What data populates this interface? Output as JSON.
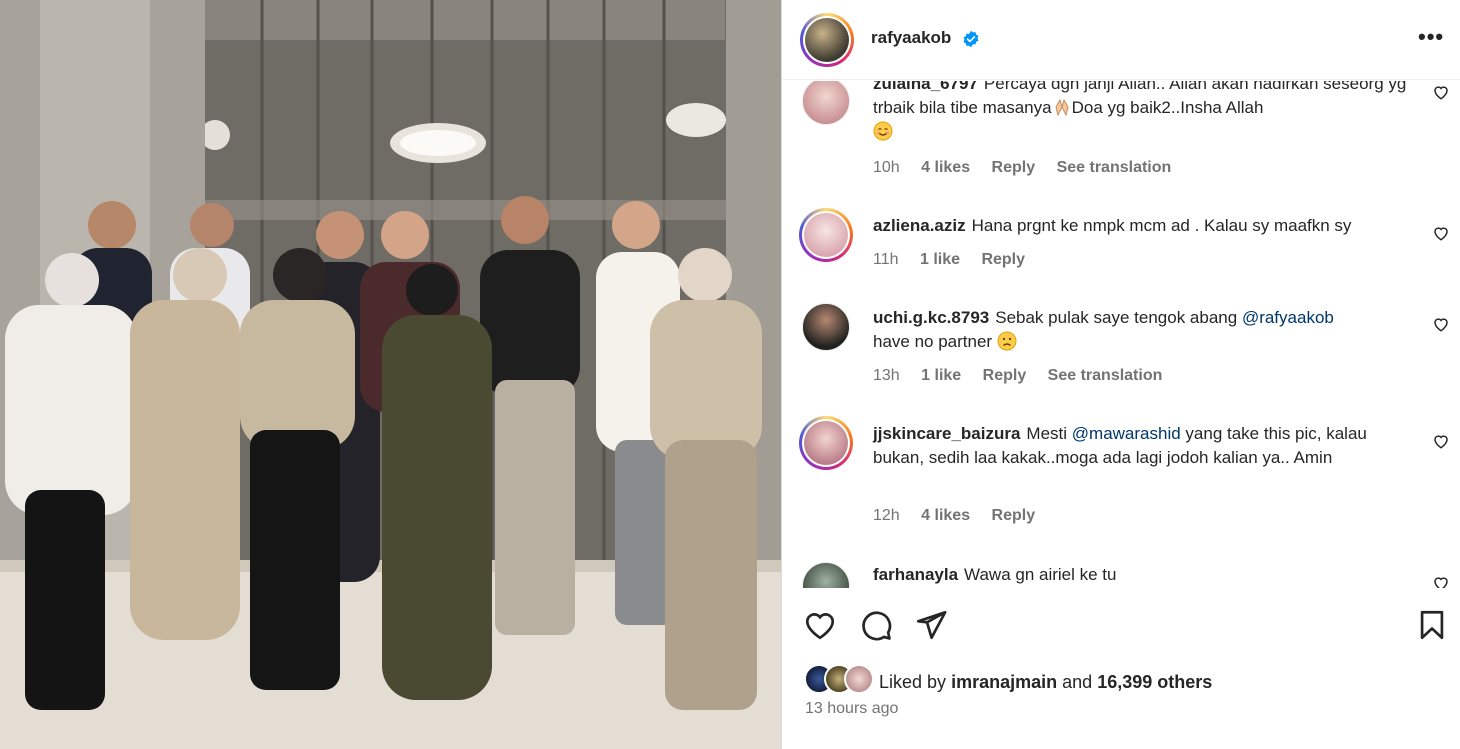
{
  "post": {
    "author": "rafyaakob",
    "verified": true,
    "photo_alt": "Group photo of ten people posing in a mirrored lobby"
  },
  "comments": [
    {
      "username": "zulaina_6797",
      "text": "Percaya dgn janji Allah.. Allah akan hadirkan seseorg yg trbaik bila tibe masanya",
      "text_after": "Doa yg baik2..Insha Allah",
      "time": "10h",
      "likes": "4 likes",
      "reply": "Reply",
      "translation": "See translation"
    },
    {
      "username": "azliena.aziz",
      "text": "Hana prgnt ke nmpk mcm ad . Kalau sy maafkn sy",
      "time": "11h",
      "likes": "1 like",
      "reply": "Reply"
    },
    {
      "username": "uchi.g.kc.8793",
      "text_before": "Sebak pulak saye tengok abang",
      "mention": "@rafyaakob",
      "text_after": "have no partner",
      "time": "13h",
      "likes": "1 like",
      "reply": "Reply",
      "translation": "See translation"
    },
    {
      "username": "jjskincare_baizura",
      "text_before": "Mesti",
      "mention": "@mawarashid",
      "text_after": "yang take this pic, kalau bukan, sedih laa kakak..moga ada lagi jodoh kalian ya.. Amin",
      "time": "12h",
      "likes": "4 likes",
      "reply": "Reply"
    },
    {
      "username": "farhanayla",
      "text": "Wawa gn airiel ke tu"
    }
  ],
  "likes": {
    "prefix": "Liked by",
    "liker": "imranajmain",
    "conjunction": "and",
    "others": "16,399 others"
  },
  "timestamp": "13 hours ago",
  "colors": {
    "verified": "#0095f6",
    "mention": "#00376b",
    "meta": "#737373"
  },
  "icons": [
    "heart-icon",
    "comment-icon",
    "share-icon",
    "save-icon",
    "more-options-icon",
    "verified-badge-icon"
  ]
}
